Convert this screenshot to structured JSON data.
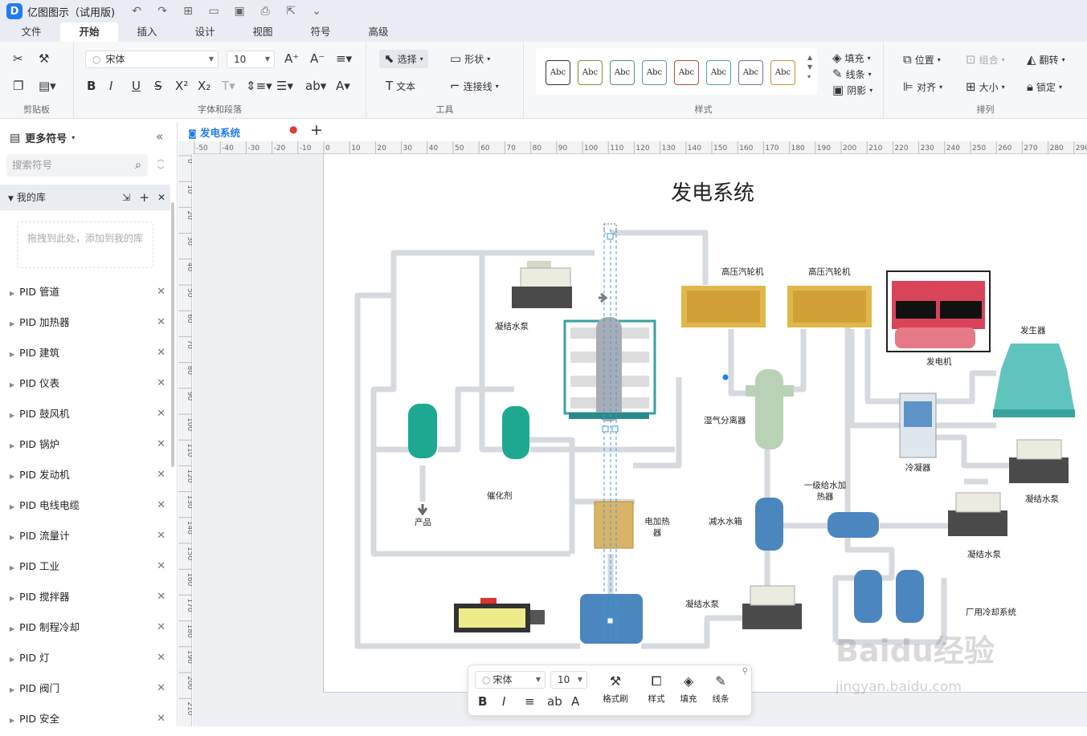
{
  "app": {
    "title": "亿图图示（试用版)",
    "logo": "D"
  },
  "menu": {
    "tabs": [
      "文件",
      "开始",
      "插入",
      "设计",
      "视图",
      "符号",
      "高级"
    ],
    "active": "开始"
  },
  "ribbon": {
    "groups": {
      "clipboard": "剪贴板",
      "font": "字体和段落",
      "tools": "工具",
      "style": "样式",
      "arrange": "排列"
    },
    "font_name": "宋体",
    "font_size": "10",
    "select_label": "选择",
    "shape_label": "形状",
    "text_label": "文本",
    "connector_label": "连接线",
    "style_sample": "Abc",
    "fill_label": "填充",
    "line_label": "线条",
    "shadow_label": "阴影",
    "position_label": "位置",
    "group_label": "组合",
    "flip_label": "翻转",
    "align_label": "对齐",
    "size_label": "大小",
    "lock_label": "锁定"
  },
  "sidebar": {
    "header": "更多符号",
    "search_placeholder": "搜索符号",
    "mylib": "我的库",
    "dropzone": "拖拽到此处，添加到我的库",
    "items": [
      "PID 管道",
      "PID 加热器",
      "PID 建筑",
      "PID 仪表",
      "PID 鼓风机",
      "PID 锅炉",
      "PID 发动机",
      "PID 电线电缆",
      "PID 流量计",
      "PID 工业",
      "PID 搅拌器",
      "PID 制程冷却",
      "PID 灯",
      "PID 阀门",
      "PID 安全"
    ]
  },
  "document": {
    "tab": "发电系统"
  },
  "ruler": {
    "h": [
      "-50",
      "-40",
      "-30",
      "-20",
      "-10",
      "0",
      "10",
      "20",
      "30",
      "40",
      "50",
      "60",
      "70",
      "80",
      "90",
      "100",
      "110",
      "120",
      "130",
      "140",
      "150",
      "160",
      "170",
      "180",
      "190",
      "200",
      "210",
      "220",
      "230",
      "240",
      "250",
      "260",
      "270",
      "280",
      "290"
    ],
    "v": [
      "0",
      "10",
      "20",
      "30",
      "40",
      "50",
      "60",
      "70",
      "80",
      "90",
      "100",
      "110",
      "120",
      "130",
      "140",
      "150",
      "160",
      "170",
      "180",
      "190",
      "200",
      "210"
    ]
  },
  "diagram": {
    "title": "发电系统",
    "labels": {
      "hp_turbine": "高压汽轮机",
      "generator_small": "发电机",
      "generator": "发生器",
      "cond_pump_top": "凝结水泵",
      "separator": "湿气分离器",
      "condenser": "冷凝器",
      "cond_pump_right": "凝结水泵",
      "feed_heater": "一级给水加热器",
      "catalyst": "催化剂",
      "product": "产品",
      "electric_heater": "电加热器",
      "deaerator": "减水水箱",
      "cond_pump_mid": "凝结水泵",
      "cond_pump_bottom": "凝结水泵",
      "plant_cooling": "厂用冷却系统"
    }
  },
  "floatbar": {
    "font_name": "宋体",
    "font_size": "10",
    "format_brush": "格式刷",
    "style": "样式",
    "fill": "填充",
    "line": "线条"
  },
  "watermark": {
    "brand": "Baidu经验",
    "url": "jingyan.baidu.com"
  }
}
